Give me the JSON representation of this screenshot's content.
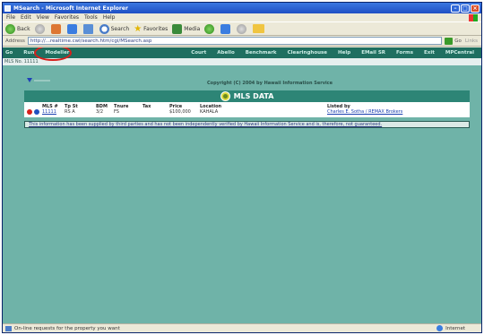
{
  "window": {
    "title": "MSearch - Microsoft Internet Explorer"
  },
  "menubar": [
    "File",
    "Edit",
    "View",
    "Favorites",
    "Tools",
    "Help"
  ],
  "toolbar": {
    "back_label": "Back",
    "search_label": "Search",
    "favorites_label": "Favorites",
    "media_label": "Media"
  },
  "addressbar": {
    "label": "Address",
    "url": "http://...realtime.cwl/search.htm/cgi/MSearch.asp",
    "go_label": "Go",
    "links_label": "Links"
  },
  "site_nav": {
    "items": [
      "Go",
      "Run",
      "Modeller",
      "",
      "",
      "Court",
      "Abello",
      "Benchmark",
      "Clearinghouse",
      "Help",
      "EMail SR",
      "Forms",
      "Exit",
      "MPCentral"
    ]
  },
  "crumb": "MLS No. 11111",
  "copyright": "Copyright (C) 2004 by Hawaii Information Service",
  "panel": {
    "title": "MLS DATA",
    "columns": [
      {
        "header": "MLS #",
        "value": "11111",
        "link": true
      },
      {
        "header": "Tp St",
        "value": "RS A",
        "link": false
      },
      {
        "header": "BDM",
        "value": "3/2",
        "link": false
      },
      {
        "header": "Tnure",
        "value": "FS",
        "link": false
      },
      {
        "header": "Tax",
        "value": "",
        "link": false
      },
      {
        "header": "Price",
        "value": "$100,000",
        "link": false
      },
      {
        "header": "Location",
        "value": "KAHALA",
        "link": false
      },
      {
        "header": "",
        "value": "",
        "link": false
      },
      {
        "header": "Listed by",
        "value": "Charles E. Sotha / REMAX Brokers",
        "link": true
      }
    ],
    "disclaimer": "This information has been supplied by third parties and has not been independently verified by Hawaii Information Service and is, therefore, not guaranteed."
  },
  "statusbar": {
    "message": "On-line requests for the property you want",
    "zone": "Internet"
  },
  "colors": {
    "page_bg": "#6fb3a8",
    "nav_bg": "#1f6f60",
    "panel_header": "#2d8576",
    "highlight_circle": "#d6201c"
  }
}
